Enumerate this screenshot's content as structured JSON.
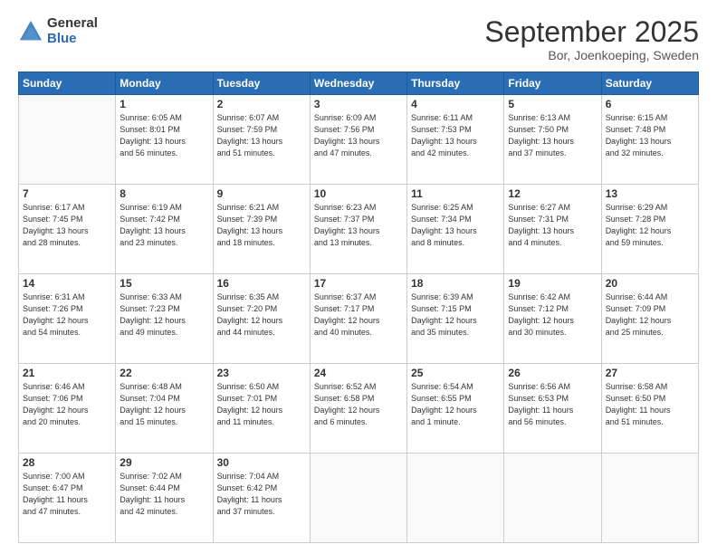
{
  "header": {
    "logo_general": "General",
    "logo_blue": "Blue",
    "month": "September 2025",
    "location": "Bor, Joenkoeping, Sweden"
  },
  "weekdays": [
    "Sunday",
    "Monday",
    "Tuesday",
    "Wednesday",
    "Thursday",
    "Friday",
    "Saturday"
  ],
  "weeks": [
    [
      {
        "day": "",
        "info": ""
      },
      {
        "day": "1",
        "info": "Sunrise: 6:05 AM\nSunset: 8:01 PM\nDaylight: 13 hours\nand 56 minutes."
      },
      {
        "day": "2",
        "info": "Sunrise: 6:07 AM\nSunset: 7:59 PM\nDaylight: 13 hours\nand 51 minutes."
      },
      {
        "day": "3",
        "info": "Sunrise: 6:09 AM\nSunset: 7:56 PM\nDaylight: 13 hours\nand 47 minutes."
      },
      {
        "day": "4",
        "info": "Sunrise: 6:11 AM\nSunset: 7:53 PM\nDaylight: 13 hours\nand 42 minutes."
      },
      {
        "day": "5",
        "info": "Sunrise: 6:13 AM\nSunset: 7:50 PM\nDaylight: 13 hours\nand 37 minutes."
      },
      {
        "day": "6",
        "info": "Sunrise: 6:15 AM\nSunset: 7:48 PM\nDaylight: 13 hours\nand 32 minutes."
      }
    ],
    [
      {
        "day": "7",
        "info": "Sunrise: 6:17 AM\nSunset: 7:45 PM\nDaylight: 13 hours\nand 28 minutes."
      },
      {
        "day": "8",
        "info": "Sunrise: 6:19 AM\nSunset: 7:42 PM\nDaylight: 13 hours\nand 23 minutes."
      },
      {
        "day": "9",
        "info": "Sunrise: 6:21 AM\nSunset: 7:39 PM\nDaylight: 13 hours\nand 18 minutes."
      },
      {
        "day": "10",
        "info": "Sunrise: 6:23 AM\nSunset: 7:37 PM\nDaylight: 13 hours\nand 13 minutes."
      },
      {
        "day": "11",
        "info": "Sunrise: 6:25 AM\nSunset: 7:34 PM\nDaylight: 13 hours\nand 8 minutes."
      },
      {
        "day": "12",
        "info": "Sunrise: 6:27 AM\nSunset: 7:31 PM\nDaylight: 13 hours\nand 4 minutes."
      },
      {
        "day": "13",
        "info": "Sunrise: 6:29 AM\nSunset: 7:28 PM\nDaylight: 12 hours\nand 59 minutes."
      }
    ],
    [
      {
        "day": "14",
        "info": "Sunrise: 6:31 AM\nSunset: 7:26 PM\nDaylight: 12 hours\nand 54 minutes."
      },
      {
        "day": "15",
        "info": "Sunrise: 6:33 AM\nSunset: 7:23 PM\nDaylight: 12 hours\nand 49 minutes."
      },
      {
        "day": "16",
        "info": "Sunrise: 6:35 AM\nSunset: 7:20 PM\nDaylight: 12 hours\nand 44 minutes."
      },
      {
        "day": "17",
        "info": "Sunrise: 6:37 AM\nSunset: 7:17 PM\nDaylight: 12 hours\nand 40 minutes."
      },
      {
        "day": "18",
        "info": "Sunrise: 6:39 AM\nSunset: 7:15 PM\nDaylight: 12 hours\nand 35 minutes."
      },
      {
        "day": "19",
        "info": "Sunrise: 6:42 AM\nSunset: 7:12 PM\nDaylight: 12 hours\nand 30 minutes."
      },
      {
        "day": "20",
        "info": "Sunrise: 6:44 AM\nSunset: 7:09 PM\nDaylight: 12 hours\nand 25 minutes."
      }
    ],
    [
      {
        "day": "21",
        "info": "Sunrise: 6:46 AM\nSunset: 7:06 PM\nDaylight: 12 hours\nand 20 minutes."
      },
      {
        "day": "22",
        "info": "Sunrise: 6:48 AM\nSunset: 7:04 PM\nDaylight: 12 hours\nand 15 minutes."
      },
      {
        "day": "23",
        "info": "Sunrise: 6:50 AM\nSunset: 7:01 PM\nDaylight: 12 hours\nand 11 minutes."
      },
      {
        "day": "24",
        "info": "Sunrise: 6:52 AM\nSunset: 6:58 PM\nDaylight: 12 hours\nand 6 minutes."
      },
      {
        "day": "25",
        "info": "Sunrise: 6:54 AM\nSunset: 6:55 PM\nDaylight: 12 hours\nand 1 minute."
      },
      {
        "day": "26",
        "info": "Sunrise: 6:56 AM\nSunset: 6:53 PM\nDaylight: 11 hours\nand 56 minutes."
      },
      {
        "day": "27",
        "info": "Sunrise: 6:58 AM\nSunset: 6:50 PM\nDaylight: 11 hours\nand 51 minutes."
      }
    ],
    [
      {
        "day": "28",
        "info": "Sunrise: 7:00 AM\nSunset: 6:47 PM\nDaylight: 11 hours\nand 47 minutes."
      },
      {
        "day": "29",
        "info": "Sunrise: 7:02 AM\nSunset: 6:44 PM\nDaylight: 11 hours\nand 42 minutes."
      },
      {
        "day": "30",
        "info": "Sunrise: 7:04 AM\nSunset: 6:42 PM\nDaylight: 11 hours\nand 37 minutes."
      },
      {
        "day": "",
        "info": ""
      },
      {
        "day": "",
        "info": ""
      },
      {
        "day": "",
        "info": ""
      },
      {
        "day": "",
        "info": ""
      }
    ]
  ]
}
